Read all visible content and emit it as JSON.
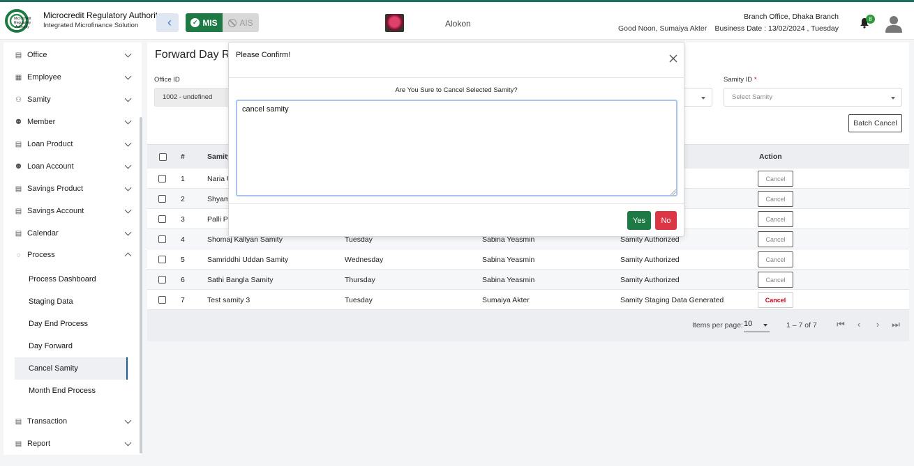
{
  "header": {
    "org_name": "Microcredit Regulatory Authority",
    "org_sub": "Integrated Microfinance Solution",
    "logo_text": "Microcredit Regulatory Authority",
    "mis_label": "MIS",
    "ais_label": "AIS",
    "brand_name": "Alokon",
    "greeting": "Good Noon, Sumaiya Akter",
    "branch": "Branch Office, Dhaka Branch",
    "business_date": "Business Date : 13/02/2024 , Tuesday",
    "notification_count": "8",
    "colors": {
      "primary": "#1e7a45",
      "danger": "#dc3545",
      "accent": "#1e5aa8"
    }
  },
  "sidebar": {
    "items": [
      {
        "label": "Office",
        "icon": "office-icon"
      },
      {
        "label": "Employee",
        "icon": "employee-icon"
      },
      {
        "label": "Samity",
        "icon": "samity-icon"
      },
      {
        "label": "Member",
        "icon": "member-icon"
      },
      {
        "label": "Loan Product",
        "icon": "loan-product-icon"
      },
      {
        "label": "Loan Account",
        "icon": "loan-account-icon"
      },
      {
        "label": "Savings Product",
        "icon": "savings-product-icon"
      },
      {
        "label": "Savings Account",
        "icon": "savings-account-icon"
      },
      {
        "label": "Calendar",
        "icon": "calendar-icon"
      },
      {
        "label": "Process",
        "icon": "process-icon"
      },
      {
        "label": "Transaction",
        "icon": "transaction-icon"
      },
      {
        "label": "Report",
        "icon": "report-icon"
      }
    ],
    "process_sub": [
      {
        "label": "Process Dashboard"
      },
      {
        "label": "Staging Data"
      },
      {
        "label": "Day End Process"
      },
      {
        "label": "Day Forward"
      },
      {
        "label": "Cancel Samity"
      },
      {
        "label": "Month End Process"
      }
    ]
  },
  "main": {
    "title": "Forward Day Re",
    "office_label": "Office ID",
    "office_value": "1002 - undefined",
    "samity_label": "Samity ID",
    "samity_required": "*",
    "samity_placeholder": "Select Samity",
    "batch_cancel": "Batch Cancel",
    "columns": {
      "index": "#",
      "samity": "Samity",
      "action": "Action"
    },
    "rows": [
      {
        "idx": "1",
        "samity": "Naria U",
        "day": "",
        "officer": "",
        "status": "",
        "action": "Cancel"
      },
      {
        "idx": "2",
        "samity": "Shyam",
        "day": "",
        "officer": "",
        "status": "",
        "action": "Cancel"
      },
      {
        "idx": "3",
        "samity": "Palli Pr",
        "day": "",
        "officer": "",
        "status": "",
        "action": "Cancel"
      },
      {
        "idx": "4",
        "samity": "Shomaj Kallyan Samity",
        "day": "Tuesday",
        "officer": "Sabina Yeasmin",
        "status": "Samity Authorized",
        "action": "Cancel"
      },
      {
        "idx": "5",
        "samity": "Samriddhi Uddan Samity",
        "day": "Wednesday",
        "officer": "Sabina Yeasmin",
        "status": "Samity Authorized",
        "action": "Cancel"
      },
      {
        "idx": "6",
        "samity": "Sathi Bangla Samity",
        "day": "Thursday",
        "officer": "Sabina Yeasmin",
        "status": "Samity Authorized",
        "action": "Cancel"
      },
      {
        "idx": "7",
        "samity": "Test samity 3",
        "day": "Tuesday",
        "officer": "Sumaiya Akter",
        "status": "Samity Staging Data Generated",
        "action": "Cancel"
      }
    ],
    "pager": {
      "label": "Items per page:",
      "size": "10",
      "range": "1 – 7 of 7",
      "first": "⏮",
      "prev": "‹",
      "next": "›",
      "last": "⏭"
    }
  },
  "modal": {
    "title": "Please Confirm!",
    "question": "Are You Sure to Cancel Selected Samity?",
    "text": "cancel samity",
    "yes": "Yes",
    "no": "No"
  }
}
